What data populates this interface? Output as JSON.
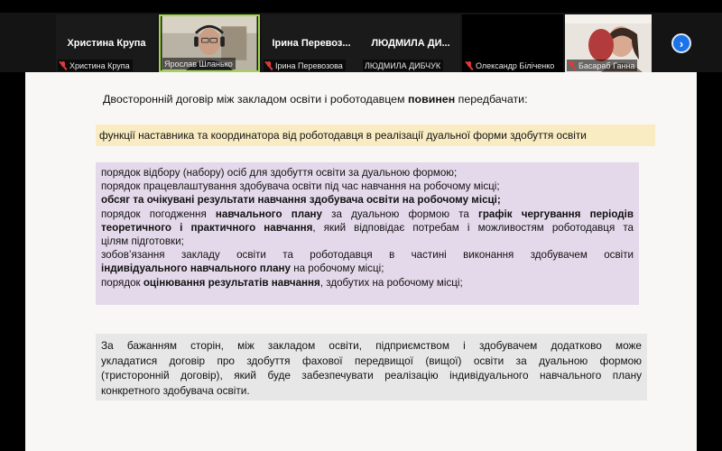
{
  "participants": [
    {
      "big_name": "Христина Крупа",
      "caption": "Христина Крупа",
      "muted": true,
      "video": false
    },
    {
      "big_name": "",
      "caption": "Ярослав Шланько",
      "muted": false,
      "video": true,
      "active": true
    },
    {
      "big_name": "Ірина  Перевоз...",
      "caption": "Ірина Перевозова",
      "muted": true,
      "video": false
    },
    {
      "big_name": "ЛЮДМИЛА ДИ...",
      "caption": "ЛЮДМИЛА ДИБЧУК",
      "muted": false,
      "video": false
    },
    {
      "big_name": "",
      "caption": "Олександр Біліченко",
      "muted": true,
      "video": false
    },
    {
      "big_name": "",
      "caption": "Басараб Ганна",
      "muted": true,
      "video": true
    }
  ],
  "next_icon": "chevron-right-icon",
  "slide": {
    "intro_prefix": "Двосторонній договір між закладом освіти і роботодавцем ",
    "intro_bold": "повинен",
    "intro_suffix": " передбачати:",
    "box1": "функції наставника та координатора від роботодавця в реалізації дуальної форми здобуття освіти",
    "box2": {
      "l1": "порядок відбору (набору) осіб для здобуття освіти за дуальною формою;",
      "l2": "порядок працевлаштування здобувача освіти під час навчання на робочому місці;",
      "l3": "обсяг та очікувані результати навчання здобувача освіти на робочому місці;",
      "l4a": "порядок погодження ",
      "l4b": "навчального плану",
      "l4c": " за дуальною формою та ",
      "l4d": "графік чергування періодів",
      "l5a": "теоретичного і практичного навчання",
      "l5b": ", який відповідає потребам і можливостям роботодавця та",
      "l6": "цілям підготовки;",
      "l7": "зобов’язання закладу освіти та роботодавця в частині виконання здобувачем освіти",
      "l8a": "індивідуального навчального плану",
      "l8b": " на робочому місці;",
      "l9a": "порядок ",
      "l9b": "оцінювання результатів навчання",
      "l9c": ", здобутих на робочому місці;"
    },
    "box3": {
      "l1": "За бажанням сторін, між закладом освіти, підприємством і здобувачем додатково може",
      "l2": "укладатися договір про здобуття фахової передвищої (вищої) освіти за дуальною формою",
      "l3": "(тристоронній договір), який буде забезпечувати реалізацію індивідуального навчального плану",
      "l4": "конкретного здобувача освіти."
    }
  }
}
